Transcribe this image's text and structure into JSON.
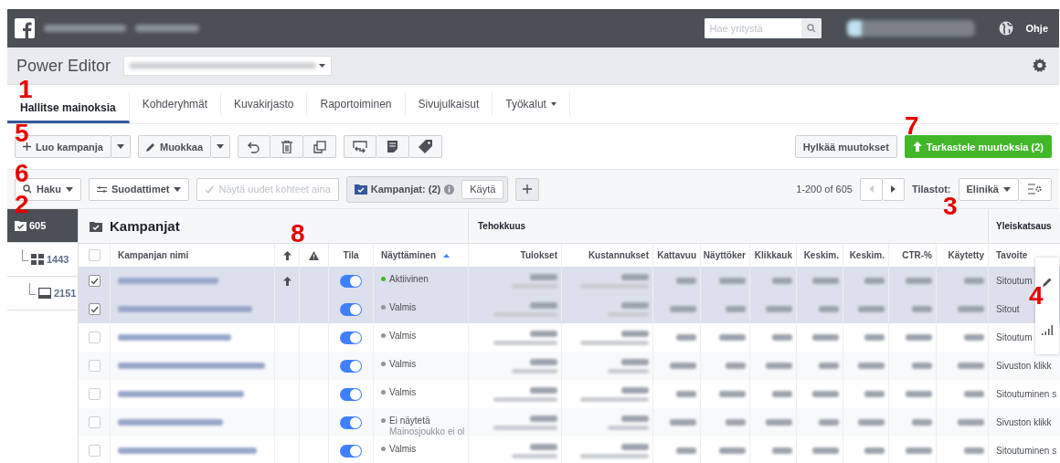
{
  "topbar": {
    "search": {
      "placeholder": "Hae yritystä"
    },
    "help": "Ohje"
  },
  "editor": {
    "title": "Power Editor"
  },
  "tabs": [
    {
      "label": "Hallitse mainoksia",
      "selected": true,
      "menu": false
    },
    {
      "label": "Kohderyhmät",
      "selected": false,
      "menu": false
    },
    {
      "label": "Kuvakirjasto",
      "selected": false,
      "menu": false
    },
    {
      "label": "Raportoiminen",
      "selected": false,
      "menu": false
    },
    {
      "label": "Sivujulkaisut",
      "selected": false,
      "menu": false
    },
    {
      "label": "Työkalut",
      "selected": false,
      "menu": true
    }
  ],
  "toolbar": {
    "create": "Luo kampanja",
    "edit": "Muokkaa",
    "discard": "Hylkää muutokset",
    "review": "Tarkastele muutoksia (2)"
  },
  "filterbar": {
    "search": "Haku",
    "filters": "Suodattimet",
    "show_new": {
      "label": "Näytä uudet kohteet aina",
      "checked": true,
      "disabled": true
    },
    "chip": "Kampanjat: (2)",
    "apply": "Käytä",
    "pagination": "1-200 of 605",
    "stats_label": "Tilastot:",
    "stats_value": "Elinikä"
  },
  "sidebar": [
    {
      "kind": "campaign",
      "count": "605",
      "selected": true,
      "children": [
        {
          "kind": "adset",
          "count": "1443",
          "selected": false,
          "children": [
            {
              "kind": "ad",
              "count": "2151",
              "selected": false
            }
          ]
        }
      ]
    }
  ],
  "table": {
    "title": "Kampanjat",
    "select_all_checked": false,
    "groups": [
      "Tehokkuus",
      "Yleiskatsaus"
    ],
    "columns": [
      "Kampanjan nimi",
      "Tila",
      "Näyttäminen",
      "Tulokset",
      "Kustannukset",
      "Kattavuu",
      "Näyttöker",
      "Klikkauk",
      "Keskim.",
      "Keskim.",
      "CTR-%",
      "Käytetty",
      "Tavoite"
    ],
    "rows": [
      {
        "selected": true,
        "checked": true,
        "pending": true,
        "on": true,
        "status": "Aktiivinen",
        "color": "#42b72a",
        "objective": "Sitoutum"
      },
      {
        "selected": true,
        "checked": true,
        "pending": false,
        "on": true,
        "status": "Valmis",
        "color": "#90949c",
        "objective": "Sitout"
      },
      {
        "selected": false,
        "checked": false,
        "pending": false,
        "on": true,
        "status": "Valmis",
        "color": "#90949c",
        "objective": "Sitoutum"
      },
      {
        "selected": false,
        "checked": false,
        "pending": false,
        "on": true,
        "status": "Valmis",
        "color": "#90949c",
        "objective": "Sivuston klikk"
      },
      {
        "selected": false,
        "checked": false,
        "pending": false,
        "on": true,
        "status": "Valmis",
        "color": "#90949c",
        "objective": "Sitoutuminen s"
      },
      {
        "selected": false,
        "checked": false,
        "pending": false,
        "on": true,
        "status": "Ei näytetä",
        "note": "Mainosjoukko ei ol",
        "color": "#90949c",
        "objective": "Sivuston klikk"
      },
      {
        "selected": false,
        "checked": false,
        "pending": false,
        "on": true,
        "status": "Valmis",
        "color": "#90949c",
        "objective": "Sitoutuminen s"
      }
    ]
  },
  "annotations": [
    "1",
    "5",
    "6",
    "2",
    "8",
    "7",
    "3",
    "4"
  ]
}
